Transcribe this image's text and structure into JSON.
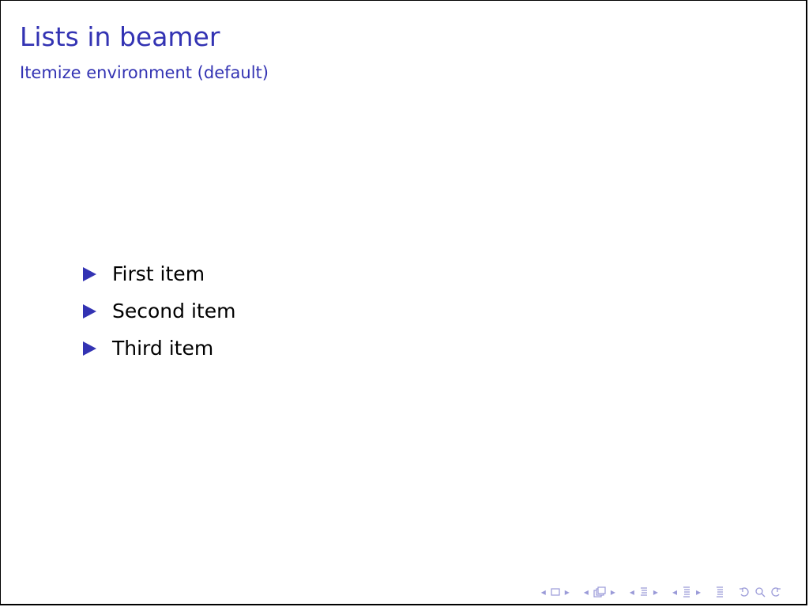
{
  "slide": {
    "title": "Lists in beamer",
    "subtitle": "Itemize environment (default)",
    "items": [
      "First item",
      "Second item",
      "Third item"
    ],
    "accent_color": "#3333b3"
  },
  "navigation": {
    "icons": [
      "prev-frame",
      "frame",
      "next-frame",
      "prev-subsection",
      "subsection",
      "next-subsection",
      "prev-section",
      "section",
      "next-section",
      "prev-part",
      "part",
      "next-part",
      "appendix",
      "back",
      "search",
      "forward"
    ]
  }
}
